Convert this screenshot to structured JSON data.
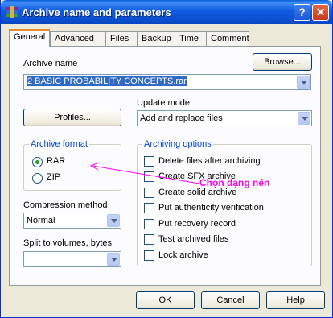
{
  "window": {
    "title": "Archive name and parameters"
  },
  "titlebar": {
    "help_label": "?",
    "close_label": "✕"
  },
  "tabs": [
    "General",
    "Advanced",
    "Files",
    "Backup",
    "Time",
    "Comment"
  ],
  "archive_name": {
    "label": "Archive name",
    "value": "2 BASIC PROBABILITY CONCEPTS.rar",
    "browse_label": "Browse..."
  },
  "update_mode": {
    "label": "Update mode",
    "value": "Add and replace files"
  },
  "profiles_label": "Profiles...",
  "archive_format": {
    "title": "Archive format",
    "options": [
      "RAR",
      "ZIP"
    ],
    "selected": "RAR"
  },
  "compression": {
    "label": "Compression method",
    "value": "Normal"
  },
  "split": {
    "label": "Split to volumes, bytes",
    "value": ""
  },
  "archiving_options": {
    "title": "Archiving options",
    "items": [
      "Delete files after archiving",
      "Create SFX archive",
      "Create solid archive",
      "Put authenticity verification",
      "Put recovery record",
      "Test archived files",
      "Lock archive"
    ]
  },
  "annotation": {
    "text": "Chọn dạng nén",
    "color": "#ff00ff"
  },
  "buttons": {
    "ok": "OK",
    "cancel": "Cancel",
    "help": "Help"
  }
}
